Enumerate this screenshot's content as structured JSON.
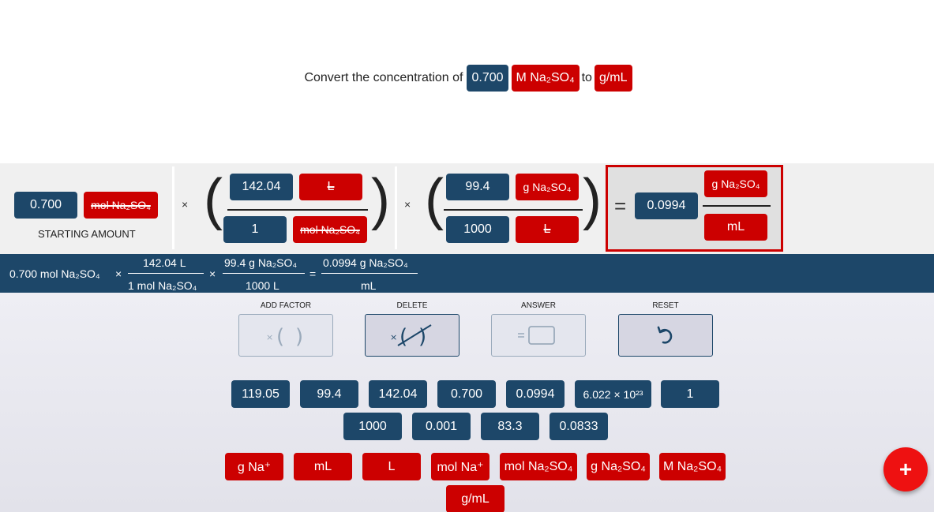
{
  "question": {
    "prefix": "Convert the concentration of",
    "value": "0.700",
    "unit": "M Na₂SO₄",
    "connector": "to",
    "target_unit": "g/mL"
  },
  "workspace": {
    "starting_value": "0.700",
    "starting_unit": "mol Na₂SO₄",
    "starting_label": "STARTING AMOUNT",
    "times": "×",
    "factor1": {
      "num_value": "142.04",
      "num_unit": "L",
      "den_value": "1",
      "den_unit": "mol Na₂SO₄"
    },
    "factor2": {
      "num_value": "99.4",
      "num_unit": "g Na₂SO₄",
      "den_value": "1000",
      "den_unit": "L"
    },
    "equals": "=",
    "answer": {
      "value": "0.0994",
      "num_unit": "g Na₂SO₄",
      "den_unit": "mL"
    }
  },
  "summary": {
    "start": "0.700 mol Na₂SO₄",
    "times": "×",
    "f1_num": "142.04 L",
    "f1_den": "1 mol Na₂SO₄",
    "f2_num": "99.4 g Na₂SO₄",
    "f2_den": "1000 L",
    "equals": "=",
    "res_num": "0.0994 g Na₂SO₄",
    "res_den": "mL"
  },
  "controls": {
    "add_factor": "ADD FACTOR",
    "delete": "DELETE",
    "answer": "ANSWER",
    "reset": "RESET"
  },
  "numbers_row1": [
    "119.05",
    "99.4",
    "142.04",
    "0.700",
    "0.0994",
    "6.022 × 10²³",
    "1"
  ],
  "numbers_row2": [
    "1000",
    "0.001",
    "83.3",
    "0.0833"
  ],
  "units_row1": [
    "g Na⁺",
    "mL",
    "L",
    "mol Na⁺",
    "mol Na₂SO₄",
    "g Na₂SO₄",
    "M Na₂SO₄"
  ],
  "units_row2": [
    "g/mL"
  ],
  "fab_label": "+",
  "colors": {
    "navy": "#1d4769",
    "red": "#cc0000"
  },
  "icons": {
    "add_factor": "multiply-parentheses-icon",
    "delete": "strikethrough-factor-icon",
    "answer": "equals-box-icon",
    "reset": "undo-arrow-icon",
    "fab": "plus-icon"
  }
}
